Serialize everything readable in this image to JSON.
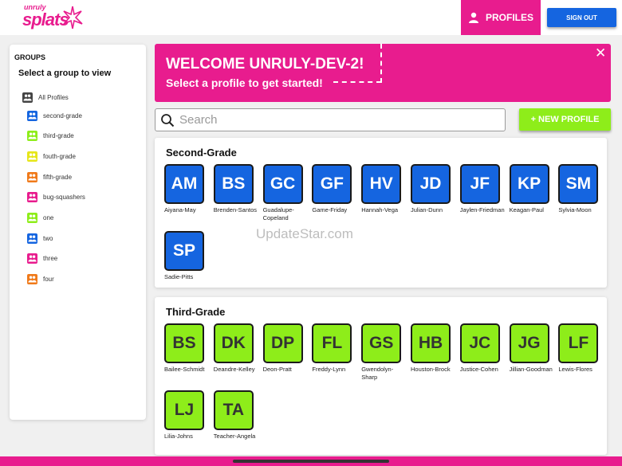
{
  "header": {
    "logo_small": "unruly",
    "logo_big": "splats",
    "profiles_label": "PROFILES",
    "signout_label": "SIGN OUT"
  },
  "colors": {
    "brand_pink": "#e81c8e",
    "blue": "#1565e0",
    "green": "#8eed1a"
  },
  "sidebar": {
    "title": "GROUPS",
    "subtitle": "Select a group to view",
    "all_label": "All Profiles",
    "groups": [
      {
        "label": "second-grade",
        "color": "#1565e0"
      },
      {
        "label": "third-grade",
        "color": "#8eed1a"
      },
      {
        "label": "fouth-grade",
        "color": "#e6e619"
      },
      {
        "label": "fifth-grade",
        "color": "#f07a1a"
      },
      {
        "label": "bug-squashers",
        "color": "#e81c8e"
      },
      {
        "label": "one",
        "color": "#8eed1a"
      },
      {
        "label": "two",
        "color": "#1565e0"
      },
      {
        "label": "three",
        "color": "#e81c8e"
      },
      {
        "label": "four",
        "color": "#f07a1a"
      }
    ]
  },
  "banner": {
    "title": "WELCOME UNRULY-DEV-2!",
    "subtitle": "Select a profile to get started!",
    "close_label": "✕"
  },
  "search": {
    "placeholder": "Search"
  },
  "new_profile_label": "+ NEW PROFILE",
  "watermark": "UpdateStar.com",
  "sections": [
    {
      "title": "Second-Grade",
      "profiles": [
        {
          "initials": "AM",
          "name": "Aiyana-May"
        },
        {
          "initials": "BS",
          "name": "Brenden-Santos"
        },
        {
          "initials": "GC",
          "name": "Guadalupe-Copeland"
        },
        {
          "initials": "GF",
          "name": "Game-Friday"
        },
        {
          "initials": "HV",
          "name": "Hannah-Vega"
        },
        {
          "initials": "JD",
          "name": "Julian-Dunn"
        },
        {
          "initials": "JF",
          "name": "Jaylen-Friedman"
        },
        {
          "initials": "KP",
          "name": "Keagan-Paul"
        },
        {
          "initials": "SM",
          "name": "Sylvia-Moon"
        },
        {
          "initials": "SP",
          "name": "Sadie-Pitts"
        }
      ]
    },
    {
      "title": "Third-Grade",
      "profiles": [
        {
          "initials": "BS",
          "name": "Bailee-Schmidt"
        },
        {
          "initials": "DK",
          "name": "Deandre-Kelley"
        },
        {
          "initials": "DP",
          "name": "Deon-Pratt"
        },
        {
          "initials": "FL",
          "name": "Freddy-Lynn"
        },
        {
          "initials": "GS",
          "name": "Gwendolyn-Sharp"
        },
        {
          "initials": "HB",
          "name": "Houston-Brock"
        },
        {
          "initials": "JC",
          "name": "Justice-Cohen"
        },
        {
          "initials": "JG",
          "name": "Jillian-Goodman"
        },
        {
          "initials": "LF",
          "name": "Lewis-Flores"
        },
        {
          "initials": "LJ",
          "name": "Lilia-Johns"
        },
        {
          "initials": "TA",
          "name": "Teacher-Angela"
        }
      ]
    }
  ]
}
